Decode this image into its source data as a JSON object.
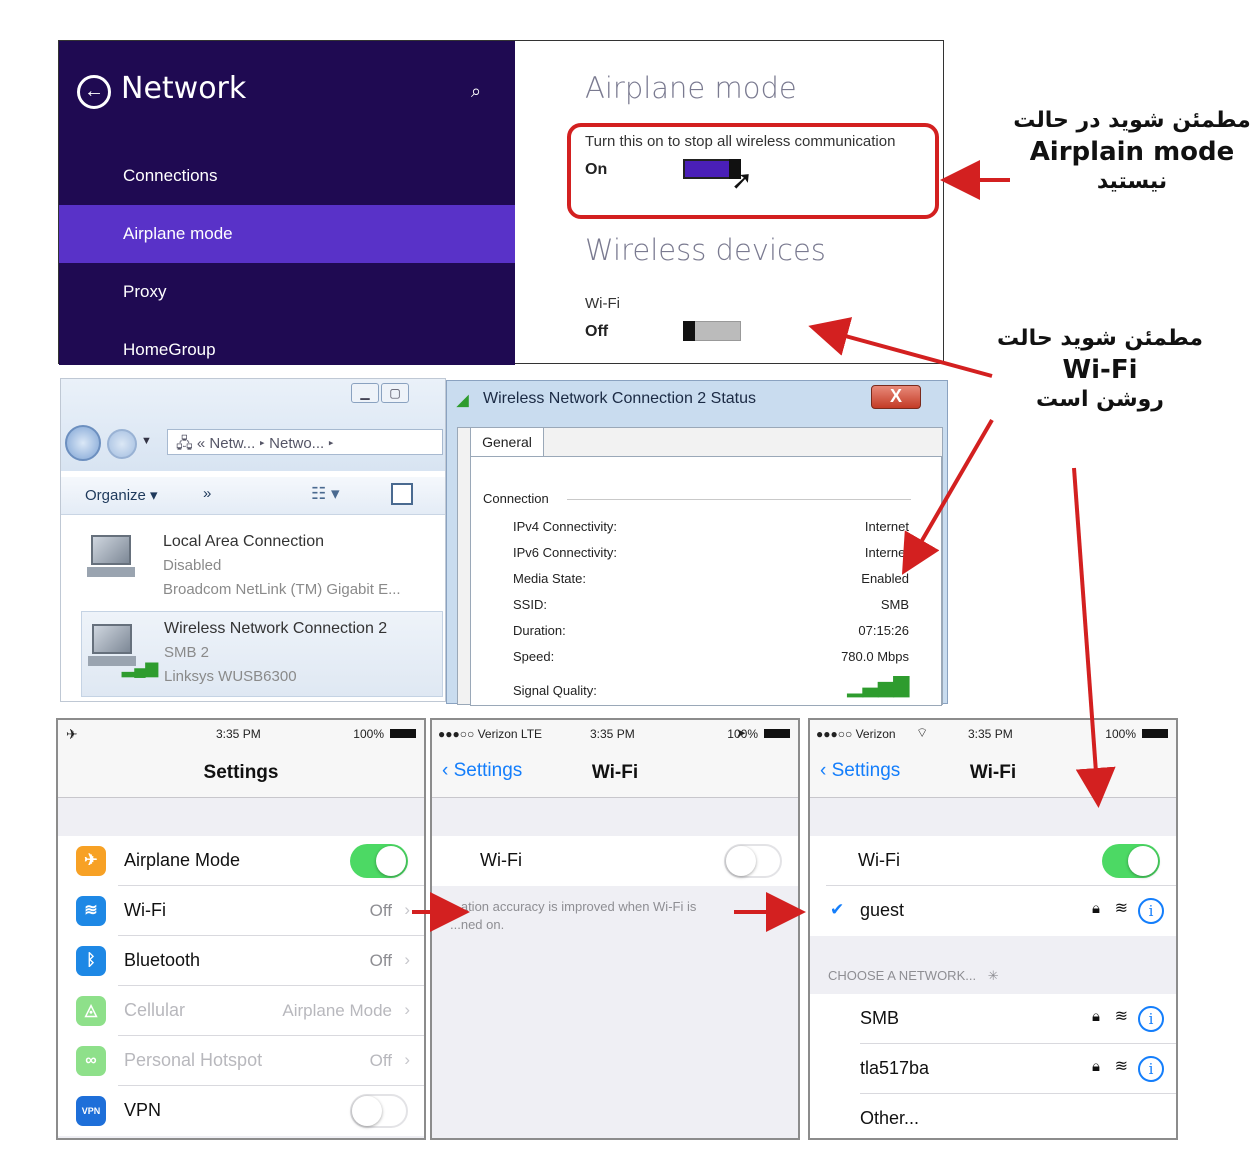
{
  "win8": {
    "panel_title": "Network",
    "menu": [
      "Connections",
      "Airplane mode",
      "Proxy",
      "HomeGroup"
    ],
    "airplane_heading": "Airplane mode",
    "airplane_desc": "Turn this on to stop all wireless communication",
    "airplane_state": "On",
    "wireless_heading": "Wireless devices",
    "wifi_label": "Wi-Fi",
    "wifi_state": "Off"
  },
  "explorer": {
    "breadcrumb": [
      "Netw...",
      "Netwo..."
    ],
    "organize": "Organize",
    "more": "»",
    "connections": [
      {
        "name": "Local Area Connection",
        "status": "Disabled",
        "device": "Broadcom NetLink (TM) Gigabit E..."
      },
      {
        "name": "Wireless Network Connection 2",
        "status": "SMB  2",
        "device": "Linksys WUSB6300"
      }
    ]
  },
  "status_dialog": {
    "title": "Wireless Network Connection 2 Status",
    "close": "X",
    "tab": "General",
    "section": "Connection",
    "rows": [
      {
        "k": "IPv4 Connectivity:",
        "v": "Internet"
      },
      {
        "k": "IPv6 Connectivity:",
        "v": "Internet"
      },
      {
        "k": "Media State:",
        "v": "Enabled"
      },
      {
        "k": "SSID:",
        "v": "SMB"
      },
      {
        "k": "Duration:",
        "v": "07:15:26"
      },
      {
        "k": "Speed:",
        "v": "780.0 Mbps"
      },
      {
        "k": "Signal Quality:",
        "v": ""
      }
    ]
  },
  "ios_settings": {
    "time": "3:35 PM",
    "battery": "100%",
    "title": "Settings",
    "rows": [
      {
        "label": "Airplane Mode",
        "value": "",
        "color": "#f7a125"
      },
      {
        "label": "Wi-Fi",
        "value": "Off",
        "color": "#1e88e5"
      },
      {
        "label": "Bluetooth",
        "value": "Off",
        "color": "#1e88e5"
      },
      {
        "label": "Cellular",
        "value": "Airplane Mode",
        "color": "#8ee08a"
      },
      {
        "label": "Personal Hotspot",
        "value": "Off",
        "color": "#8ee08a"
      },
      {
        "label": "VPN",
        "value": "",
        "color": "#1e6fd9"
      }
    ],
    "vpn_badge": "VPN"
  },
  "ios_wifi_off": {
    "carrier": "●●●○○ Verizon  LTE",
    "time": "3:35 PM",
    "battery": "100%",
    "back": "Settings",
    "title": "Wi-Fi",
    "wifi_label": "Wi-Fi",
    "footnote_line1": "...ation accuracy is improved when Wi-Fi is",
    "footnote_line2": "...ned on."
  },
  "ios_wifi_on": {
    "carrier": "●●●○○ Verizon",
    "time": "3:35 PM",
    "battery": "100%",
    "back": "Settings",
    "title": "Wi-Fi",
    "wifi_label": "Wi-Fi",
    "connected": "guest",
    "choose_header": "CHOOSE A NETWORK...",
    "networks": [
      "SMB",
      "tla517ba"
    ],
    "other": "Other..."
  },
  "notes": {
    "airplane": [
      "مطمئن شوید در حالت",
      "Airplain mode",
      "نیستید"
    ],
    "wifi": [
      "مطمئن شوید حالت",
      "Wi-Fi",
      "روشن است"
    ]
  },
  "colors": {
    "win8_bg": "#1f0a52",
    "win8_active": "#5932c8",
    "ios_green": "#4cd964",
    "ios_blue": "#147efb",
    "arrow_red": "#d32020"
  }
}
